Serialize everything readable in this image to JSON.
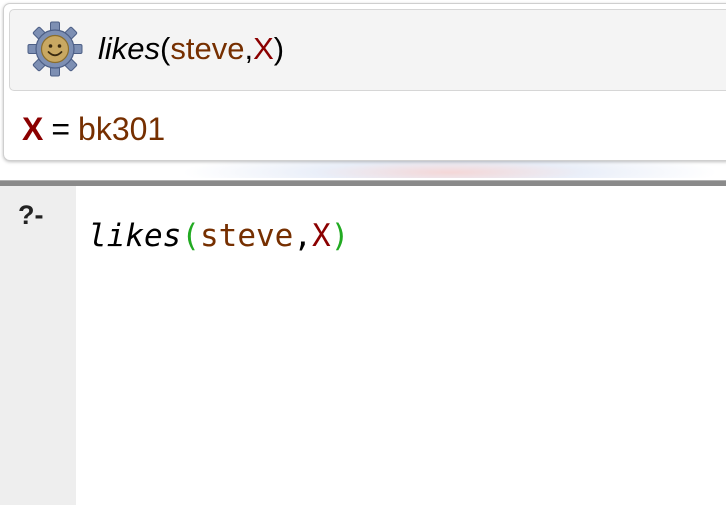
{
  "answer": {
    "icon": "swi-prolog-logo-icon",
    "query": {
      "predicate": "likes",
      "open_paren": "(",
      "arg1": "steve",
      "comma": ",",
      "arg2": "X",
      "close_paren": ")"
    },
    "binding": {
      "variable": "X",
      "equals": "=",
      "value": "bk301"
    }
  },
  "editor": {
    "prompt": "?-",
    "query": {
      "predicate": "likes",
      "open_paren": "(",
      "arg1": "steve",
      "comma": ",",
      "arg2": "X",
      "close_paren": ")"
    }
  },
  "colors": {
    "atom": "#762f00",
    "variable": "#8b0000",
    "paren": "#22aa22",
    "gutter": "#eeeeee",
    "splitter": "#8a8a8a"
  }
}
